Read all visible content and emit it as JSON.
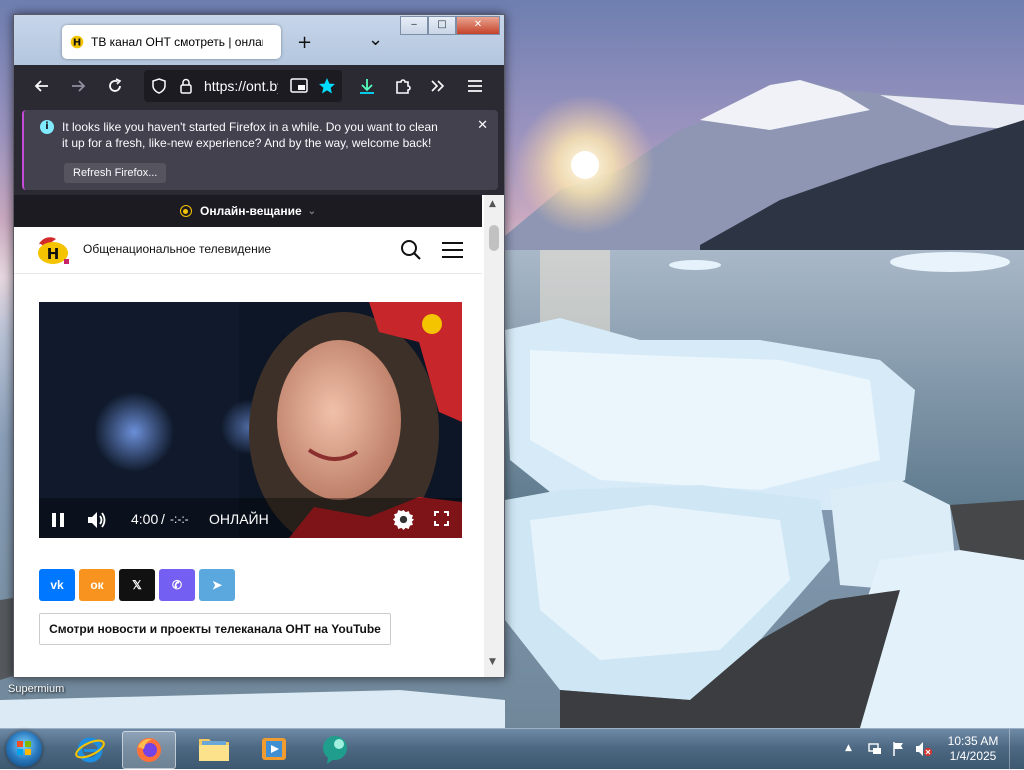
{
  "desktop": {
    "icon_label": "Supermium"
  },
  "browser": {
    "tab_title": "ТВ канал ОНТ смотреть | онлайн",
    "new_tab_symbol": "+",
    "tab_list_symbol": "⌄",
    "url": "https://ont.by",
    "window_controls": {
      "minimize": "‒",
      "maximize": "□",
      "close": "✕"
    },
    "notification": {
      "info_symbol": "i",
      "message": "It looks like you haven't started Firefox in a while. Do you want to clean it up for a fresh, like-new experience? And by the way, welcome back!",
      "button_label": "Refresh Firefox...",
      "close_symbol": "✕"
    }
  },
  "page": {
    "live_label": "Онлайн-вещание",
    "site_name": "Общенациональное телевидение",
    "player": {
      "time": "4:00",
      "separator": "/",
      "duration": "-:-:-",
      "status": "ОНЛАЙН"
    },
    "share_buttons": [
      {
        "name": "vk",
        "label": "vk",
        "color": "#0077ff"
      },
      {
        "name": "ok",
        "label": "ок",
        "color": "#f7931e"
      },
      {
        "name": "x",
        "label": "𝕏",
        "color": "#111111"
      },
      {
        "name": "viber",
        "label": "✆",
        "color": "#7360f2"
      },
      {
        "name": "telegram",
        "label": "➤",
        "color": "#5aa8dd"
      }
    ],
    "youtube_button": "Смотри новости и проекты телеканала ОНТ на YouTube"
  },
  "taskbar": {
    "time": "10:35 AM",
    "date": "1/4/2025",
    "tray_arrow": "▲"
  }
}
